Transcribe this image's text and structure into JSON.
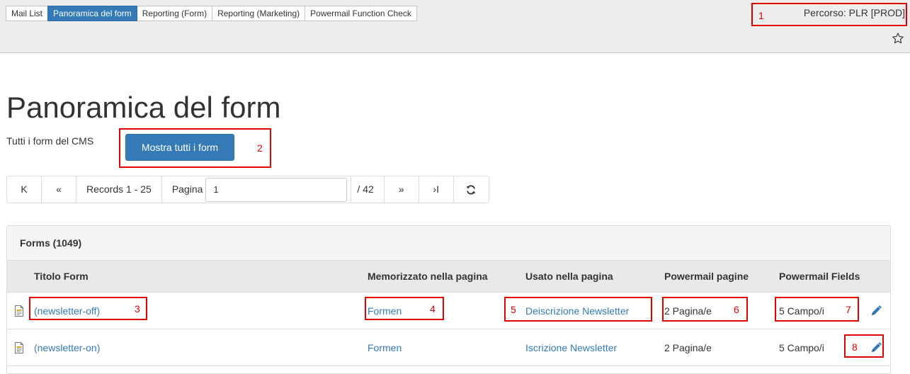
{
  "toolbar": {
    "tabs": [
      {
        "label": "Mail List",
        "active": false
      },
      {
        "label": "Panoramica del form",
        "active": true
      },
      {
        "label": "Reporting (Form)",
        "active": false
      },
      {
        "label": "Reporting (Marketing)",
        "active": false
      },
      {
        "label": "Powermail Function Check",
        "active": false
      }
    ],
    "path": "Percorso: PLR [PROD]",
    "bookmark_icon": "star-icon"
  },
  "main": {
    "title": "Panoramica del form",
    "description": "Tutti i form del CMS",
    "show_all_button": "Mostra tutti i form"
  },
  "pagination": {
    "first": "K",
    "prev": "«",
    "records": "Records 1 - 25",
    "page_label": "Pagina",
    "page_value": "1",
    "total": "/ 42",
    "next": "»",
    "last": "›I",
    "refresh_icon": "refresh-icon"
  },
  "table": {
    "heading": "Forms (1049)",
    "columns": [
      "Titolo Form",
      "Memorizzato nella pagina",
      "Usato nella pagina",
      "Powermail pagine",
      "Powermail Fields"
    ],
    "rows": [
      {
        "title": "(newsletter-off)",
        "stored": "Formen",
        "used": "Deiscrizione Newsletter",
        "pages": "2 Pagina/e",
        "fields": "5 Campo/i"
      },
      {
        "title": "(newsletter-on)",
        "stored": "Formen",
        "used": "Iscrizione Newsletter",
        "pages": "2 Pagina/e",
        "fields": "5 Campo/i"
      }
    ]
  },
  "annotations": [
    "1",
    "2",
    "3",
    "4",
    "5",
    "6",
    "7",
    "8"
  ],
  "colors": {
    "accent": "#337ab7",
    "annotation": "#e10000"
  }
}
